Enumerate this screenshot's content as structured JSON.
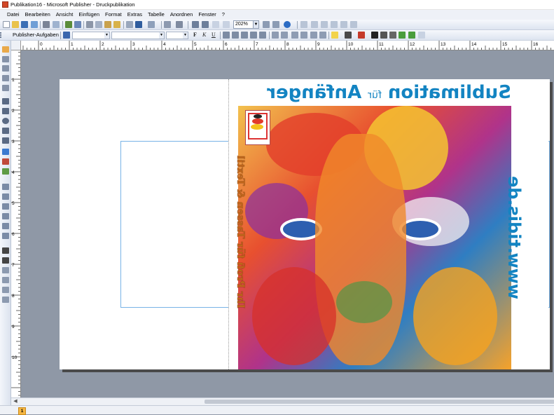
{
  "window": {
    "title": "Publikation16 - Microsoft Publisher - Druckpublikation"
  },
  "menu": {
    "items": [
      "Datei",
      "Bearbeiten",
      "Ansicht",
      "Einfügen",
      "Format",
      "Extras",
      "Tabelle",
      "Anordnen",
      "Fenster",
      "?"
    ]
  },
  "toolbar": {
    "zoom_value": "202%",
    "task_pane_label": "Publisher-Aufgaben",
    "font_name": "",
    "font_size": "",
    "format_letters": [
      "F",
      "K",
      "U"
    ]
  },
  "rulers": {
    "horizontal_numbers": [
      "0",
      "1",
      "2",
      "3",
      "4",
      "5",
      "6",
      "7",
      "8",
      "9",
      "10",
      "11",
      "12",
      "13",
      "14",
      "15",
      "16"
    ],
    "vertical_numbers": [
      "1",
      "2",
      "3",
      "4",
      "5",
      "6",
      "7",
      "8",
      "9",
      "10"
    ]
  },
  "design": {
    "headline_main": "Sublimation",
    "headline_small": "für",
    "headline_end": "Anfänger",
    "url": "www.tidis.de",
    "slogan": "Ihr Profi für Tassen & Textil",
    "colors": {
      "headline": "#1384c2",
      "slogan": "#c0661a"
    }
  },
  "status": {
    "page_number": "1"
  }
}
